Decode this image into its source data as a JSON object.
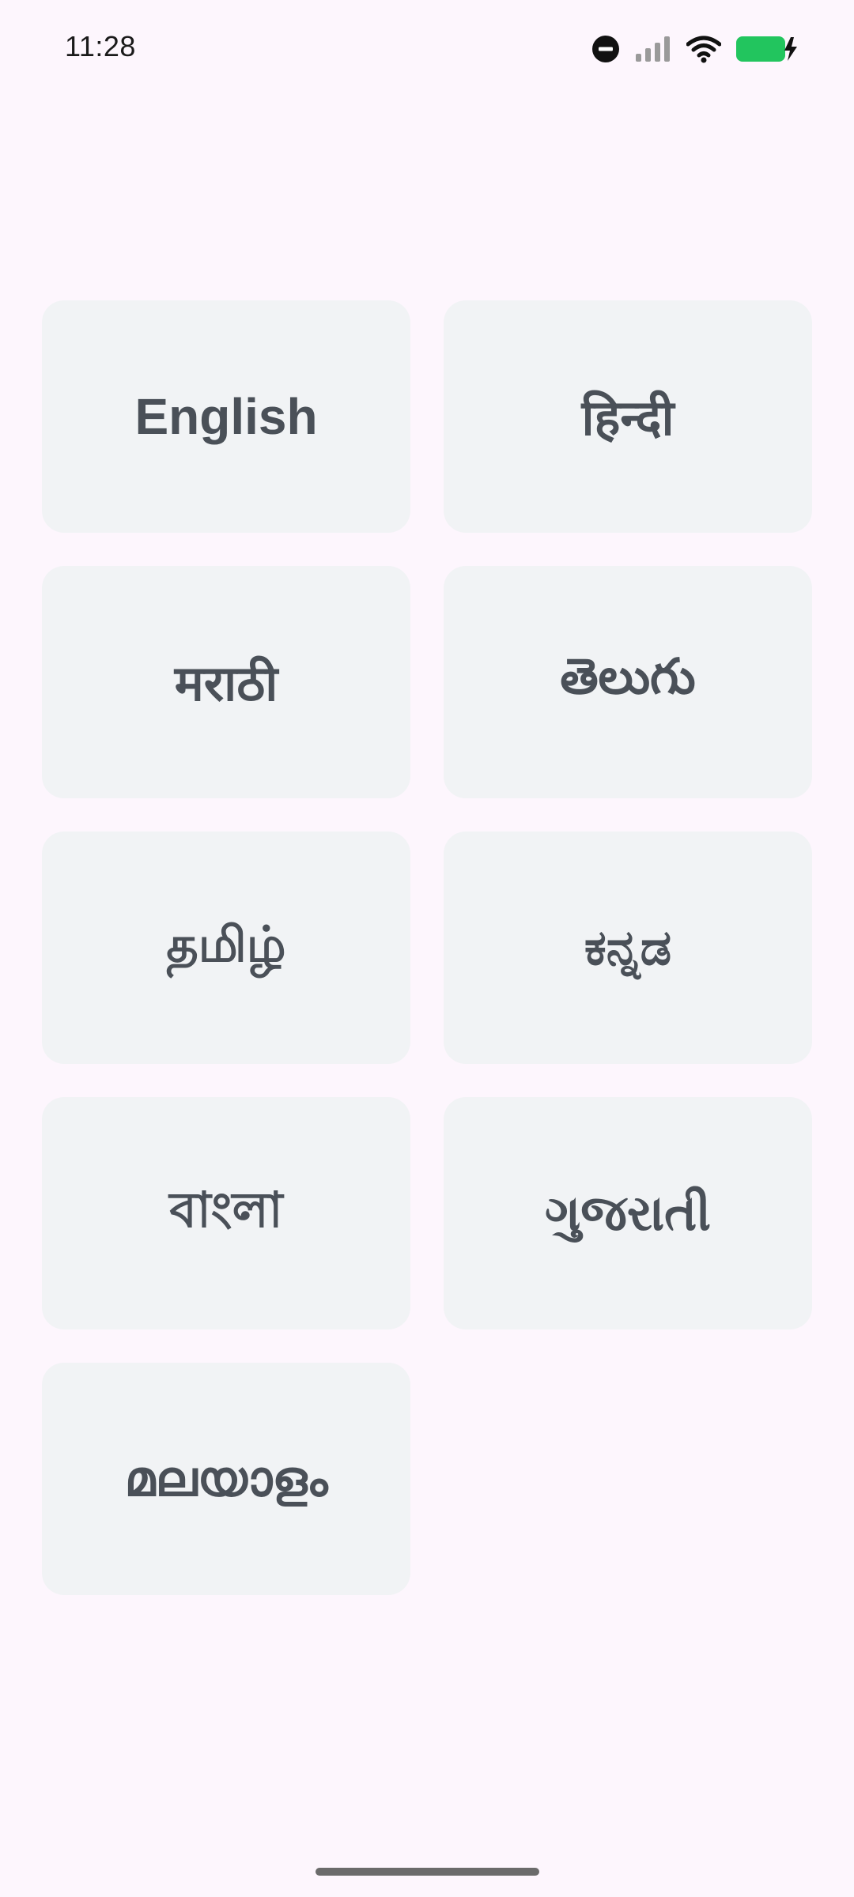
{
  "status_bar": {
    "time": "11:28",
    "icons": [
      "do-not-disturb-icon",
      "signal-icon",
      "wifi-icon",
      "battery-charging-icon"
    ],
    "battery_color": "#22c55e"
  },
  "languages": [
    {
      "id": "english",
      "label": "English"
    },
    {
      "id": "hindi",
      "label": "हिन्दी"
    },
    {
      "id": "marathi",
      "label": "मराठी"
    },
    {
      "id": "telugu",
      "label": "తెలుగు"
    },
    {
      "id": "tamil",
      "label": "தமிழ்"
    },
    {
      "id": "kannada",
      "label": "ಕನ್ನಡ"
    },
    {
      "id": "bengali",
      "label": "বাংলা"
    },
    {
      "id": "gujarati",
      "label": "ગુજરાતી"
    },
    {
      "id": "malayalam",
      "label": "മലയാളം"
    }
  ]
}
